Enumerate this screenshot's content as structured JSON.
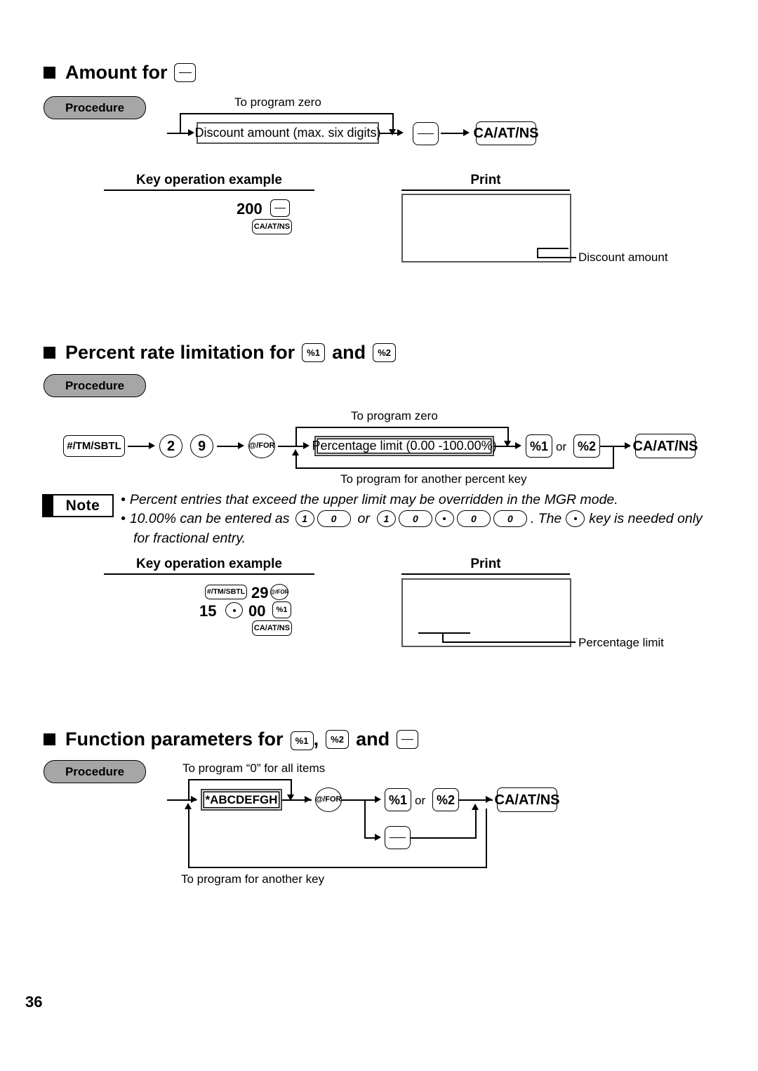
{
  "page": {
    "number": "36"
  },
  "icons": {
    "minus_key": "minus-circle-key-icon",
    "percent1_key": "%1",
    "percent2_key": "%2",
    "ca_at_ns_key": "CA/AT/NS",
    "tm_sbtl_key": "#/TM/SBTL",
    "at_for_key": "@/FOR",
    "decimal_key": "decimal-point-key-icon"
  },
  "sections": [
    {
      "id": "amount-for-minus",
      "title_prefix": "Amount for",
      "procedure_label": "Procedure",
      "flow": {
        "top_label": "To program zero",
        "box_text": "Discount amount (max. six digits)",
        "key_after": "minus",
        "final_key": "CA/AT/NS"
      },
      "example": {
        "col_left": "Key operation example",
        "col_right": "Print",
        "keys_line1_value": "200",
        "keys_line1_key": "minus",
        "keys_line2_key": "CA/AT/NS",
        "print_leader_label": "Discount amount"
      }
    },
    {
      "id": "percent-rate-limitation",
      "title_prefix": "Percent rate limitation for",
      "title_middle": "and",
      "procedure_label": "Procedure",
      "flow": {
        "top_label": "To program zero",
        "bottom_label": "To program for another percent key",
        "start_key": "#/TM/SBTL",
        "digits": [
          "2",
          "9"
        ],
        "for_key": "@/FOR",
        "box_text": "Percentage limit (0.00 -100.00%)",
        "or_text": "or",
        "key_a": "%1",
        "key_b": "%2",
        "final_key": "CA/AT/NS"
      },
      "note": {
        "badge": "Note",
        "lines": [
          "Percent entries that exceed the upper limit may be overridden in the MGR mode.",
          "10.00% can be entered as",
          "for fractional entry."
        ],
        "line2_keys_a": [
          "1",
          "0"
        ],
        "line2_or": "or",
        "line2_keys_b": [
          "1",
          "0",
          ".",
          "0",
          "0"
        ],
        "line2_tail_a": ". The",
        "line2_tail_b": "key is needed only"
      },
      "example": {
        "col_left": "Key operation example",
        "col_right": "Print",
        "line1_key1": "#/TM/SBTL",
        "line1_value": "29",
        "line1_key2": "@/FOR",
        "line2_value1": "15",
        "line2_dot": "decimal",
        "line2_value2": "00",
        "line2_key": "%1",
        "line3_key": "CA/AT/NS",
        "print_leader_label": "Percentage limit"
      }
    },
    {
      "id": "function-parameters",
      "title_prefix": "Function parameters for",
      "title_comma": ",",
      "title_middle": "and",
      "procedure_label": "Procedure",
      "flow": {
        "top_label": "To program “0” for all items",
        "bottom_label": "To program for another key",
        "box_text": "*ABCDEFGH",
        "for_key": "@/FOR",
        "or_text": "or",
        "key_a": "%1",
        "key_b": "%2",
        "key_c": "minus",
        "final_key": "CA/AT/NS"
      }
    }
  ]
}
